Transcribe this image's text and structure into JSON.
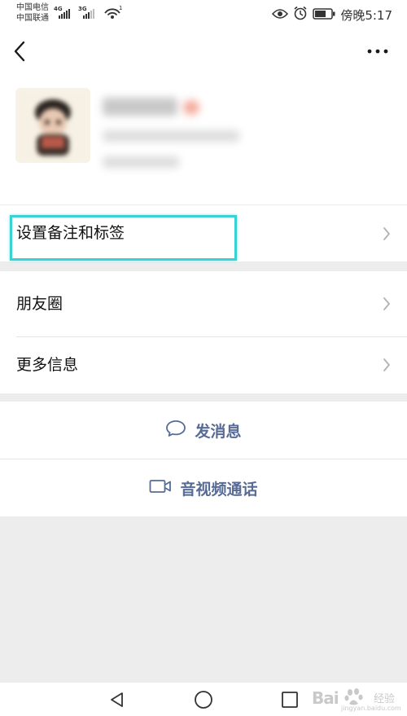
{
  "status_bar": {
    "carrier_1": "中国电信",
    "carrier_2": "中国联通",
    "network_1": "4G",
    "network_2": "3G",
    "time": "傍晚5:17",
    "icons": [
      "signal-icon",
      "wifi-icon",
      "eye-icon",
      "alarm-icon",
      "battery-icon"
    ]
  },
  "nav": {
    "back_icon": "back-chevron-icon",
    "more_icon": "more-dots-icon"
  },
  "profile": {
    "avatar": "avatar",
    "name_visible": false
  },
  "menu_group_1": {
    "items": [
      {
        "label": "设置备注和标签",
        "icon": "chevron-right-icon",
        "highlighted": true
      }
    ]
  },
  "menu_group_2": {
    "items": [
      {
        "label": "朋友圈",
        "icon": "chevron-right-icon"
      },
      {
        "label": "更多信息",
        "icon": "chevron-right-icon"
      }
    ]
  },
  "actions": {
    "send_message": {
      "label": "发消息",
      "icon": "chat-bubble-icon"
    },
    "video_call": {
      "label": "音视频通话",
      "icon": "video-camera-icon"
    }
  },
  "system_nav": {
    "icons": [
      "back-triangle-icon",
      "home-circle-icon",
      "recents-square-icon"
    ]
  },
  "watermark": {
    "brand": "Bai",
    "product": "经验",
    "url": "jingyan.baidu.com"
  },
  "colors": {
    "background": "#ededed",
    "surface": "#ffffff",
    "link": "#576b95",
    "highlight": "#3ad1d4",
    "divider": "#e5e5e5"
  }
}
